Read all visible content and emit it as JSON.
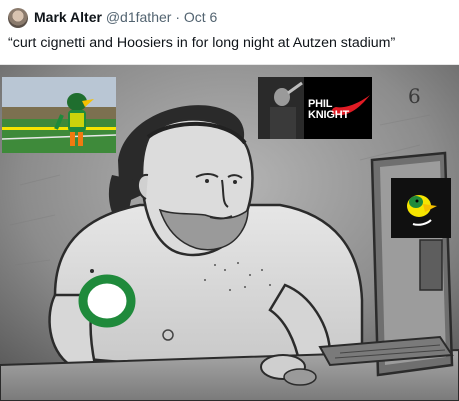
{
  "tweet": {
    "display_name": "Mark Alter",
    "handle": "@d1father",
    "separator": "·",
    "date": "Oct 6",
    "text": "“curt cignetti and Hoosiers in for long night at Autzen stadium”"
  },
  "meme": {
    "inset_knight_label_line1": "PHIL",
    "inset_knight_label_line2": "KNIGHT",
    "chest_logo_letter": "O",
    "wall_scribble": "6"
  },
  "colors": {
    "oregon_green": "#1f8a3b",
    "oregon_yellow": "#f6e500",
    "nike_red": "#e01b24",
    "meme_gray_bg": "#8f8f8f"
  },
  "icons": [
    "avatar",
    "nike-swoosh-icon",
    "oregon-o-logo",
    "duck-logo-icon"
  ]
}
